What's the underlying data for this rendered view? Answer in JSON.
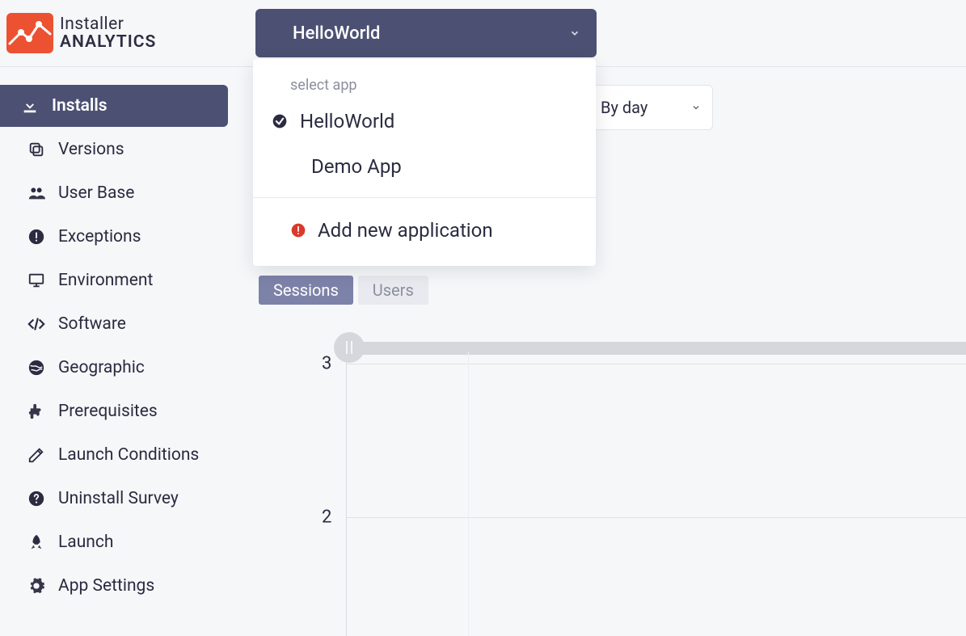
{
  "brand": {
    "line1": "Installer",
    "line2": "ANALYTICS"
  },
  "app_selector": {
    "selected": "HelloWorld",
    "hint": "select app",
    "options": [
      "HelloWorld",
      "Demo App"
    ],
    "add_label": "Add new application"
  },
  "granularity": {
    "label": "By day"
  },
  "sidebar": {
    "items": [
      {
        "label": "Installs",
        "icon": "download-icon",
        "active": true
      },
      {
        "label": "Versions",
        "icon": "copy-icon"
      },
      {
        "label": "User Base",
        "icon": "users-icon"
      },
      {
        "label": "Exceptions",
        "icon": "alert-circle-icon"
      },
      {
        "label": "Environment",
        "icon": "monitor-icon"
      },
      {
        "label": "Software",
        "icon": "code-icon"
      },
      {
        "label": "Geographic",
        "icon": "globe-icon"
      },
      {
        "label": "Prerequisites",
        "icon": "puzzle-icon"
      },
      {
        "label": "Launch Conditions",
        "icon": "edit-icon"
      },
      {
        "label": "Uninstall Survey",
        "icon": "help-circle-icon"
      },
      {
        "label": "Launch",
        "icon": "rocket-icon"
      },
      {
        "label": "App Settings",
        "icon": "gear-icon"
      }
    ]
  },
  "tabs": {
    "items": [
      "Sessions",
      "Users"
    ],
    "active": "Sessions"
  },
  "chart_data": {
    "type": "line",
    "title": "",
    "xlabel": "",
    "ylabel": "",
    "ylim": [
      0,
      3
    ],
    "yticks": [
      2,
      3
    ],
    "series": [],
    "categories": []
  }
}
